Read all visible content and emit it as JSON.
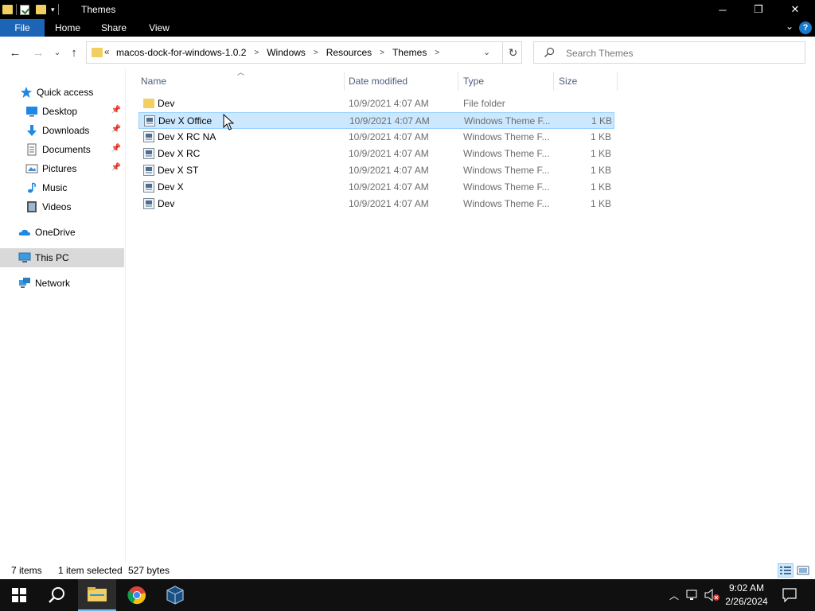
{
  "window": {
    "title": "Themes",
    "minimize_glyph": "─",
    "maximize_glyph": "❐",
    "close_glyph": "✕"
  },
  "ribbon": {
    "tabs": [
      "File",
      "Home",
      "Share",
      "View"
    ],
    "help": "?"
  },
  "address": {
    "overflow": "«",
    "crumbs": [
      "macos-dock-for-windows-1.0.2",
      "Windows",
      "Resources",
      "Themes"
    ],
    "search_placeholder": "Search Themes"
  },
  "nav": {
    "quick_access": "Quick access",
    "items": [
      {
        "label": "Desktop",
        "icon": "desktop-icon",
        "pinned": true
      },
      {
        "label": "Downloads",
        "icon": "downloads-icon",
        "pinned": true
      },
      {
        "label": "Documents",
        "icon": "documents-icon",
        "pinned": true
      },
      {
        "label": "Pictures",
        "icon": "pictures-icon",
        "pinned": true
      },
      {
        "label": "Music",
        "icon": "music-icon",
        "pinned": false
      },
      {
        "label": "Videos",
        "icon": "videos-icon",
        "pinned": false
      }
    ],
    "onedrive": "OneDrive",
    "this_pc": "This PC",
    "network": "Network"
  },
  "columns": {
    "name": "Name",
    "date": "Date modified",
    "type": "Type",
    "size": "Size"
  },
  "files": [
    {
      "name": "Dev",
      "date": "10/9/2021 4:07 AM",
      "type": "File folder",
      "size": "",
      "kind": "folder",
      "selected": false
    },
    {
      "name": "Dev X Office",
      "date": "10/9/2021 4:07 AM",
      "type": "Windows Theme F...",
      "size": "1 KB",
      "kind": "theme",
      "selected": true
    },
    {
      "name": "Dev X RC NA",
      "date": "10/9/2021 4:07 AM",
      "type": "Windows Theme F...",
      "size": "1 KB",
      "kind": "theme",
      "selected": false
    },
    {
      "name": "Dev X RC",
      "date": "10/9/2021 4:07 AM",
      "type": "Windows Theme F...",
      "size": "1 KB",
      "kind": "theme",
      "selected": false
    },
    {
      "name": "Dev X ST",
      "date": "10/9/2021 4:07 AM",
      "type": "Windows Theme F...",
      "size": "1 KB",
      "kind": "theme",
      "selected": false
    },
    {
      "name": "Dev X",
      "date": "10/9/2021 4:07 AM",
      "type": "Windows Theme F...",
      "size": "1 KB",
      "kind": "theme",
      "selected": false
    },
    {
      "name": "Dev",
      "date": "10/9/2021 4:07 AM",
      "type": "Windows Theme F...",
      "size": "1 KB",
      "kind": "theme",
      "selected": false
    }
  ],
  "status": {
    "items": "7 items",
    "selected": "1 item selected",
    "bytes": "527 bytes"
  },
  "taskbar": {
    "time": "9:02 AM",
    "date": "2/26/2024"
  },
  "colors": {
    "selection_bg": "#cce8ff",
    "selection_border": "#99d1ff",
    "file_tab": "#1c64b5",
    "folder": "#f2cf62"
  }
}
